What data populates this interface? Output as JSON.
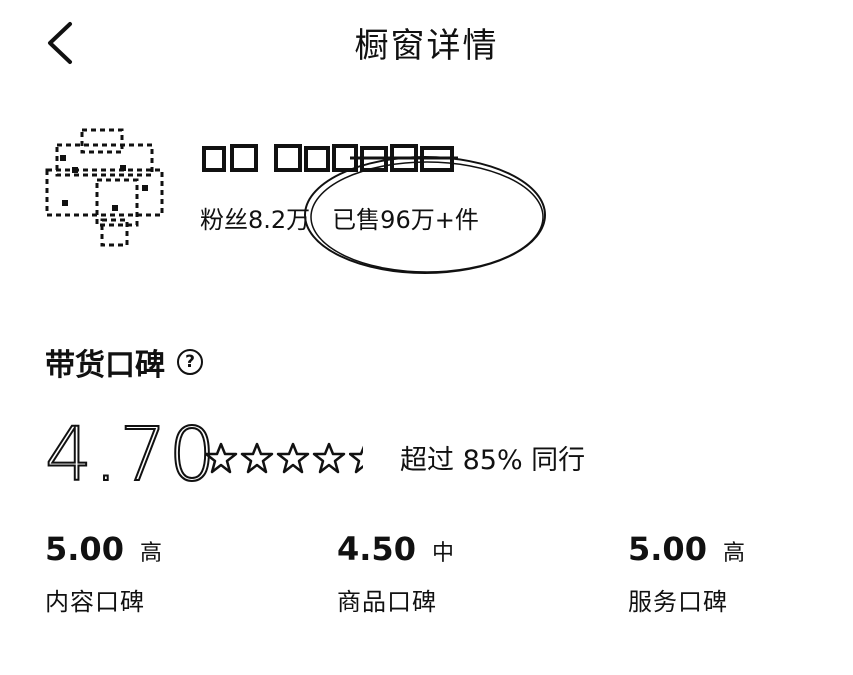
{
  "header": {
    "title": "橱窗详情"
  },
  "shop": {
    "followers": "粉丝8.2万",
    "sold": "已售96万+件"
  },
  "reputation": {
    "title": "带货口碑",
    "score": "4.70",
    "rating": 4.7,
    "beyond_text": "超过 85% 同行",
    "metrics": [
      {
        "value": "5.00",
        "level": "高",
        "label": "内容口碑"
      },
      {
        "value": "4.50",
        "level": "中",
        "label": "商品口碑"
      },
      {
        "value": "5.00",
        "level": "高",
        "label": "服务口碑"
      }
    ]
  }
}
